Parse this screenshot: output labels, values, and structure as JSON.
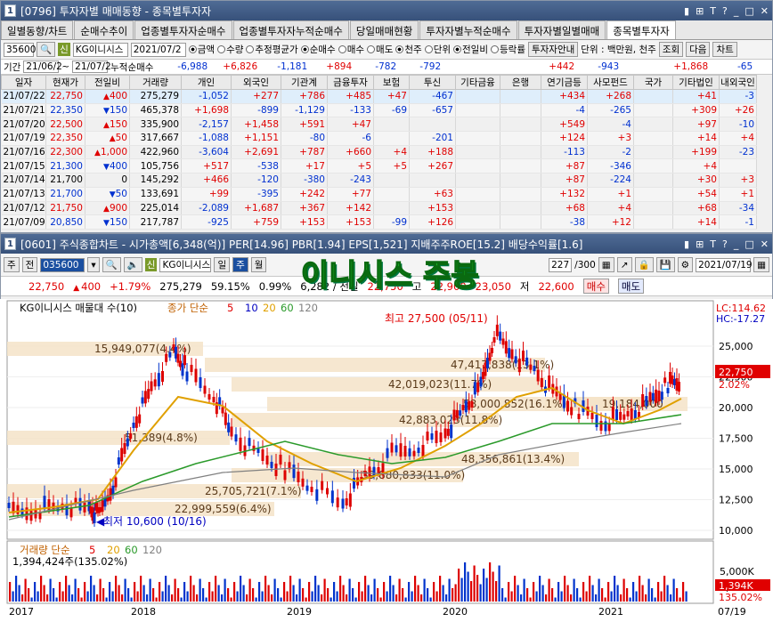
{
  "win1": {
    "num": "1",
    "title": "[0796] 투자자별 매매동향 - 종목별투자자",
    "ctrls": [
      "▮",
      "⊞",
      "T",
      "?",
      "_",
      "□",
      "✕"
    ]
  },
  "tabs": [
    "일별동향/차트",
    "순매수추이",
    "업종별투자자순매수",
    "업종별투자자누적순매수",
    "당일매매현황",
    "투자자별누적순매수",
    "투자자별일별매매",
    "종목별투자자"
  ],
  "toolbar1": {
    "code": "35600",
    "name": "KG이니시스",
    "date": "2021/07/2",
    "radios": [
      "금액",
      "수량",
      "추정평균가",
      "순매수",
      "매수",
      "매도",
      "천주",
      "단위",
      "전일비",
      "등락률"
    ],
    "btn1": "투자자안내",
    "note": "단위 : 백만원, 천주",
    "btn2": "조회",
    "btn3": "다음",
    "btn4": "차트"
  },
  "period": {
    "label": "기간",
    "from": "21/06/2",
    "to": "21/07/2",
    "cum_label": "누적순매수",
    "cum": [
      "-6,988",
      "+6,826",
      "-1,181",
      "+894",
      "-782",
      "-792",
      "",
      "",
      "+442",
      "-943",
      "",
      "+1,868",
      "-65"
    ]
  },
  "grid": {
    "headers": [
      "일자",
      "현재가",
      "전일비",
      "거래량",
      "개인",
      "외국인",
      "기관계",
      "금융투자",
      "보험",
      "투신",
      "기타금융",
      "은행",
      "연기금등",
      "사모펀드",
      "국가",
      "기타법인",
      "내외국인"
    ],
    "rows": [
      [
        "21/07/22",
        "22,750",
        "400",
        "275,279",
        "-1,052",
        "+277",
        "+786",
        "+485",
        "+47",
        "-467",
        "",
        "",
        "+434",
        "+268",
        "",
        "+41",
        "-3"
      ],
      [
        "21/07/21",
        "22,350",
        "150",
        "465,378",
        "+1,698",
        "-899",
        "-1,129",
        "-133",
        "-69",
        "-657",
        "",
        "",
        "-4",
        "-265",
        "",
        "+309",
        "+26"
      ],
      [
        "21/07/20",
        "22,500",
        "150",
        "335,900",
        "-2,157",
        "+1,458",
        "+591",
        "+47",
        "",
        "",
        "",
        "",
        "+549",
        "-4",
        "",
        "+97",
        "-10"
      ],
      [
        "21/07/19",
        "22,350",
        "50",
        "317,667",
        "-1,088",
        "+1,151",
        "-80",
        "-6",
        "",
        "-201",
        "",
        "",
        "+124",
        "+3",
        "",
        "+14",
        "+4"
      ],
      [
        "21/07/16",
        "22,300",
        "1,000",
        "422,960",
        "-3,604",
        "+2,691",
        "+787",
        "+660",
        "+4",
        "+188",
        "",
        "",
        "-113",
        "-2",
        "",
        "+199",
        "-23"
      ],
      [
        "21/07/15",
        "21,300",
        "400",
        "105,756",
        "+517",
        "-538",
        "+17",
        "+5",
        "+5",
        "+267",
        "",
        "",
        "+87",
        "-346",
        "",
        "+4",
        ""
      ],
      [
        "21/07/14",
        "21,700",
        "0",
        "145,292",
        "+466",
        "-120",
        "-380",
        "-243",
        "",
        "",
        "",
        "",
        "+87",
        "-224",
        "",
        "+30",
        "+3"
      ],
      [
        "21/07/13",
        "21,700",
        "50",
        "133,691",
        "+99",
        "-395",
        "+242",
        "+77",
        "",
        "+63",
        "",
        "",
        "+132",
        "+1",
        "",
        "+54",
        "+1"
      ],
      [
        "21/07/12",
        "21,750",
        "900",
        "225,014",
        "-2,089",
        "+1,687",
        "+367",
        "+142",
        "",
        "+153",
        "",
        "",
        "+68",
        "+4",
        "",
        "+68",
        "-34"
      ],
      [
        "21/07/09",
        "20,850",
        "150",
        "217,787",
        "-925",
        "+759",
        "+153",
        "+153",
        "-99",
        "+126",
        "",
        "",
        "-38",
        "+12",
        "",
        "+14",
        "-1"
      ]
    ],
    "dirs": [
      "up",
      "dn",
      "up",
      "up",
      "up",
      "dn",
      "",
      "dn",
      "up",
      "dn"
    ]
  },
  "win2": {
    "num": "1",
    "title": "[0601] 주식종합차트 - 시가총액[6,348(억)] PER[14.96] PBR[1.94] EPS[1,521] 지배주주ROE[15.2] 배당수익률[1.6]",
    "ctrls": [
      "▮",
      "⊞",
      "T",
      "?",
      "_",
      "□",
      "✕"
    ]
  },
  "toolbar2": {
    "kind": "주",
    "prev": "전",
    "code": "035600",
    "name": "KG이니시스",
    "period": "일",
    "week": "주",
    "month": "월",
    "count": "227",
    "total": "/300",
    "date": "2021/07/19"
  },
  "overlay": "이니시스 주봉",
  "quote": {
    "price": "22,750",
    "change": "400",
    "pct": "+1.79%",
    "volume": "275,279",
    "ratio": "59.15%",
    "pct2": "0.99%",
    "extra": "6,282 / 전일 ",
    "open": "22,750",
    "high_label": "고",
    "high": "22,900",
    "h2": "23,050",
    "low_label": "저",
    "low": "22,600",
    "buy": "매수",
    "sell": "매도"
  },
  "chart": {
    "legend_name": "KG이니시스 매물대 수(10)",
    "legend_ma": "종가 단순",
    "ma": [
      "5",
      "10",
      "20",
      "60",
      "120"
    ],
    "ma_colors": [
      "#e00000",
      "#0000c0",
      "#e0a000",
      "#2a9a2a",
      "#808080"
    ],
    "lc": "LC:114.62",
    "hc": "HC:-17.27",
    "price_tag": "22,750",
    "pct_tag": "2.02%",
    "max_label": "최고 27,500 (05/11)",
    "min_label": "최저 10,600 (10/16)",
    "zones": [
      "15,949,077(4.4%)",
      "47,417,838(13.1%)",
      "42,019,023(11.7%)",
      "58,000,852(16.1%)",
      "19,184,000",
      "42,883,023(11.8%)",
      "51,389(4.8%)",
      "48,356,861(13.4%)",
      "39,880,833(11.0%)",
      "25,705,721(7.1%)",
      "22,999,559(6.4%)"
    ],
    "y_labels": [
      "25,000",
      "22,500",
      "20,000",
      "17,500",
      "15,000",
      "12,500",
      "10,000"
    ],
    "x_labels": [
      "2017",
      "2018",
      "2019",
      "2020",
      "2021",
      "07/19"
    ]
  },
  "volume": {
    "legend": "거래량 단순",
    "ma": [
      "5",
      "20",
      "60",
      "120"
    ],
    "ma_colors": [
      "#e00000",
      "#e0a000",
      "#2a9a2a",
      "#808080"
    ],
    "info": "1,394,424주(135.02%)",
    "y_labels": [
      "5,000K",
      "2,500K"
    ],
    "tag": "1,394K",
    "tag2": "135.02%"
  }
}
